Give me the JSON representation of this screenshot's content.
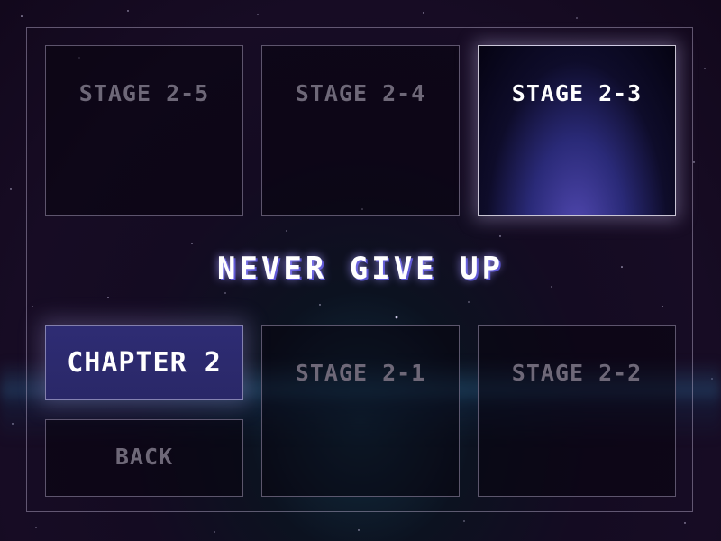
{
  "stages_top": [
    {
      "label": "STAGE 2-5",
      "selected": false
    },
    {
      "label": "STAGE 2-4",
      "selected": false
    },
    {
      "label": "STAGE 2-3",
      "selected": true
    }
  ],
  "motto": "NEVER GIVE UP",
  "chapter": {
    "label": "CHAPTER 2"
  },
  "back": {
    "label": "BACK"
  },
  "stages_bottom": [
    {
      "label": "STAGE 2-1",
      "selected": false
    },
    {
      "label": "STAGE 2-2",
      "selected": false
    }
  ],
  "colors": {
    "selected_tile": "#2a2a78",
    "chapter_banner": "#2e2c74",
    "inactive_text": "#6e6878",
    "motto_shadow": "#4a44c8"
  }
}
